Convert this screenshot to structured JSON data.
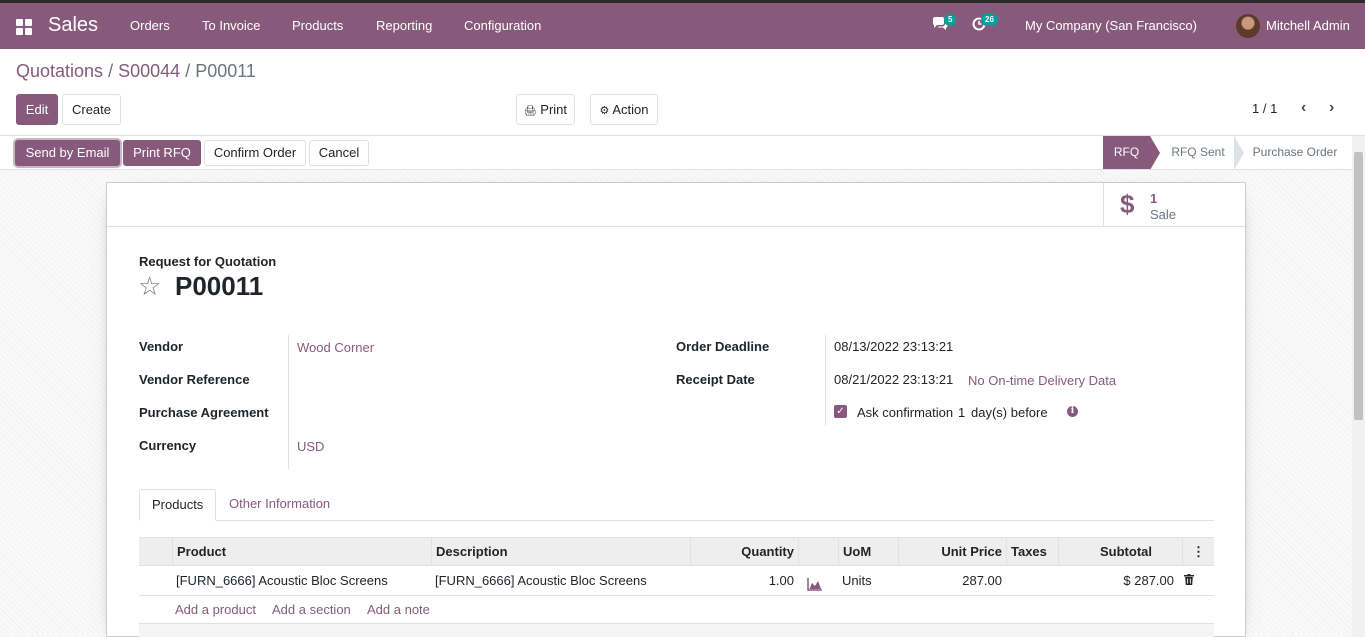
{
  "navbar": {
    "app_name": "Sales",
    "menu": [
      "Orders",
      "To Invoice",
      "Products",
      "Reporting",
      "Configuration"
    ],
    "messages_count": "5",
    "activities_count": "26",
    "company": "My Company (San Francisco)",
    "user": "Mitchell Admin"
  },
  "breadcrumb": {
    "root": "Quotations",
    "parent": "S00044",
    "current": "P00011",
    "separator": "/"
  },
  "control": {
    "edit": "Edit",
    "create": "Create",
    "print": "Print",
    "action": "Action",
    "pager": "1 / 1"
  },
  "statusbar": {
    "buttons": [
      "Send by Email",
      "Print RFQ",
      "Confirm Order",
      "Cancel"
    ],
    "stages": [
      "RFQ",
      "RFQ Sent",
      "Purchase Order"
    ],
    "active_stage": "RFQ"
  },
  "smart_button": {
    "value": "1",
    "label": "Sale"
  },
  "document": {
    "kind": "Request for Quotation",
    "name": "P00011"
  },
  "fields_left": {
    "vendor_label": "Vendor",
    "vendor": "Wood Corner",
    "vendor_ref_label": "Vendor Reference",
    "agreement_label": "Purchase Agreement",
    "currency_label": "Currency",
    "currency": "USD"
  },
  "fields_right": {
    "deadline_label": "Order Deadline",
    "deadline": "08/13/2022 23:13:21",
    "receipt_label": "Receipt Date",
    "receipt": "08/21/2022 23:13:21",
    "ontime": "No On-time Delivery Data",
    "ask_confirmation": "Ask confirmation",
    "days": "1",
    "days_suffix": "day(s) before"
  },
  "tabs": [
    "Products",
    "Other Information"
  ],
  "table": {
    "headers": {
      "product": "Product",
      "description": "Description",
      "quantity": "Quantity",
      "uom": "UoM",
      "unit_price": "Unit Price",
      "taxes": "Taxes",
      "subtotal": "Subtotal"
    },
    "rows": [
      {
        "product": "[FURN_6666] Acoustic Bloc Screens",
        "description": "[FURN_6666] Acoustic Bloc Screens",
        "quantity": "1.00",
        "uom": "Units",
        "unit_price": "287.00",
        "taxes": "",
        "subtotal": "$ 287.00"
      }
    ],
    "add_links": [
      "Add a product",
      "Add a section",
      "Add a note"
    ]
  },
  "colors": {
    "brand": "#875a7b",
    "badge": "#00a09d"
  },
  "icons": {
    "apps": "apps-grid-icon",
    "messages": "comments-icon",
    "activities": "clock-icon",
    "print": "print-icon",
    "action": "gear-icon",
    "dollar": "dollar-icon",
    "star": "star-icon",
    "forecast": "area-chart-icon",
    "delete": "trash-icon",
    "info": "info-icon"
  }
}
